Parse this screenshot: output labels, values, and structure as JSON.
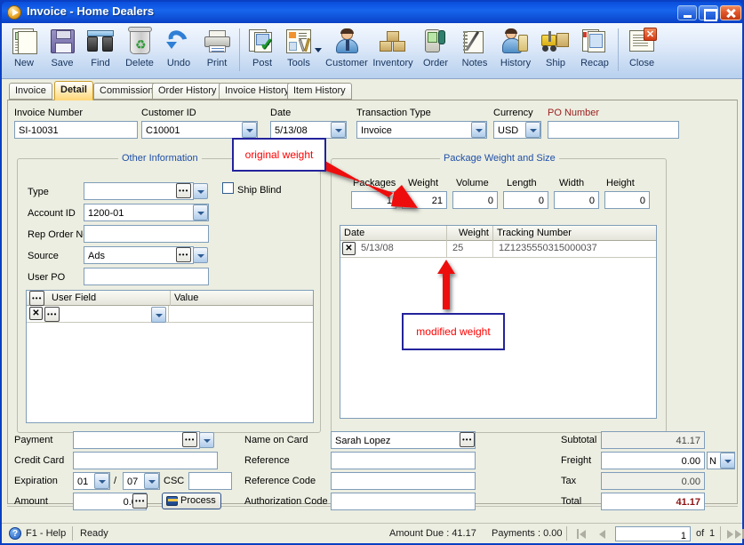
{
  "window": {
    "title": "Invoice - Home Dealers",
    "icon": "app-play-icon",
    "minimize_label": "Minimize",
    "maximize_label": "Maximize",
    "close_label": "Close"
  },
  "toolbar": {
    "buttons": [
      {
        "label": "New",
        "icon": "new-document-icon"
      },
      {
        "label": "Save",
        "icon": "floppy-disk-icon"
      },
      {
        "label": "Find",
        "icon": "binoculars-icon"
      },
      {
        "label": "Delete",
        "icon": "recycle-bin-icon"
      },
      {
        "label": "Undo",
        "icon": "undo-arrow-icon"
      },
      {
        "label": "Print",
        "icon": "printer-icon"
      },
      {
        "label": "Post",
        "icon": "post-checkmark-icon"
      },
      {
        "label": "Tools",
        "icon": "tools-wrench-icon"
      },
      {
        "label": "Customer",
        "icon": "customer-person-icon"
      },
      {
        "label": "Inventory",
        "icon": "inventory-boxes-icon"
      },
      {
        "label": "Order",
        "icon": "order-device-icon"
      },
      {
        "label": "Notes",
        "icon": "notepad-pen-icon"
      },
      {
        "label": "History",
        "icon": "history-hourglass-icon"
      },
      {
        "label": "Ship",
        "icon": "ship-forklift-icon"
      },
      {
        "label": "Recap",
        "icon": "recap-pages-icon"
      },
      {
        "label": "Close",
        "icon": "close-window-icon"
      }
    ]
  },
  "tabs": [
    {
      "label": "Invoice",
      "active": false
    },
    {
      "label": "Detail",
      "active": true
    },
    {
      "label": "Commission",
      "active": false
    },
    {
      "label": "Order History",
      "active": false
    },
    {
      "label": "Invoice History",
      "active": false
    },
    {
      "label": "Item History",
      "active": false
    }
  ],
  "header_fields": {
    "invoice_number": {
      "label": "Invoice Number",
      "value": "SI-10031"
    },
    "customer_id": {
      "label": "Customer ID",
      "value": "C10001"
    },
    "date": {
      "label": "Date",
      "value": "5/13/08"
    },
    "transaction_type": {
      "label": "Transaction Type",
      "value": "Invoice"
    },
    "currency": {
      "label": "Currency",
      "value": "USD"
    },
    "po_number": {
      "label": "PO Number",
      "value": ""
    }
  },
  "other_information": {
    "title": "Other Information",
    "type": {
      "label": "Type",
      "value": ""
    },
    "account_id": {
      "label": "Account ID",
      "value": "1200-01"
    },
    "rep_order_no": {
      "label": "Rep Order No",
      "value": ""
    },
    "source": {
      "label": "Source",
      "value": "Ads"
    },
    "user_po": {
      "label": "User PO",
      "value": ""
    },
    "ship_blind": {
      "label": "Ship Blind",
      "checked": false
    },
    "user_field_grid": {
      "columns": [
        "User Field",
        "Value"
      ],
      "rows": [
        {
          "user_field": "",
          "value": ""
        }
      ]
    }
  },
  "package_weight_and_size": {
    "title": "Package Weight and Size",
    "fields": [
      {
        "label": "Packages",
        "value": "1"
      },
      {
        "label": "Weight",
        "value": "21"
      },
      {
        "label": "Volume",
        "value": "0"
      },
      {
        "label": "Length",
        "value": "0"
      },
      {
        "label": "Width",
        "value": "0"
      },
      {
        "label": "Height",
        "value": "0"
      }
    ],
    "tracking_grid": {
      "columns": [
        "Date",
        "Weight",
        "Tracking Number"
      ],
      "rows": [
        {
          "date": "5/13/08",
          "weight": "25",
          "tracking_number": "1Z1235550315000037"
        }
      ]
    }
  },
  "payment": {
    "payment": {
      "label": "Payment",
      "value": ""
    },
    "credit_card": {
      "label": "Credit Card",
      "value": ""
    },
    "expiration": {
      "label": "Expiration",
      "month": "01",
      "separator": "/",
      "year": "07"
    },
    "csc": {
      "label": "CSC",
      "value": ""
    },
    "amount": {
      "label": "Amount",
      "value": "0.00"
    },
    "process_button": "Process"
  },
  "card_info": {
    "name_on_card": {
      "label": "Name on Card",
      "value": "Sarah  Lopez"
    },
    "reference": {
      "label": "Reference",
      "value": ""
    },
    "reference_code": {
      "label": "Reference Code",
      "value": ""
    },
    "authorization_code": {
      "label": "Authorization Code",
      "value": ""
    }
  },
  "totals": {
    "subtotal": {
      "label": "Subtotal",
      "value": "41.17"
    },
    "freight": {
      "label": "Freight",
      "value": "0.00",
      "taxable": "N"
    },
    "tax": {
      "label": "Tax",
      "value": "0.00"
    },
    "total": {
      "label": "Total",
      "value": "41.17"
    }
  },
  "annotations": [
    {
      "id": "original-weight",
      "text": "original weight"
    },
    {
      "id": "modified-weight",
      "text": "modified weight"
    }
  ],
  "statusbar": {
    "help": "F1 - Help",
    "state": "Ready",
    "amount_due": "Amount Due : 41.17",
    "payments": "Payments : 0.00",
    "record": "1",
    "of_label": "of",
    "total_records": "1"
  },
  "colors": {
    "title_bar": "#1766ec",
    "group_title": "#1f4fa8",
    "required_label": "#9c2020",
    "total_value": "#8c1212",
    "annotation_text": "#ff0000",
    "annotation_border": "#23239c",
    "arrow": "#ee1111",
    "client_bg": "#eceee1"
  }
}
